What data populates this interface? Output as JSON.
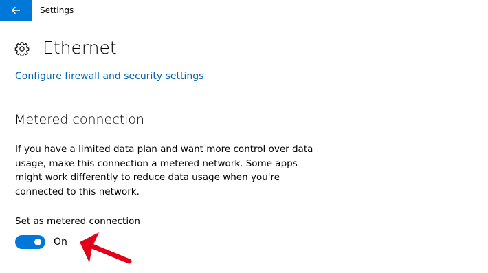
{
  "window": {
    "title": "Settings",
    "back_icon": "arrow-left-icon",
    "accent": "#0078d7"
  },
  "header": {
    "icon": "gear-icon",
    "title": "Ethernet"
  },
  "links": {
    "firewall": "Configure firewall and security settings",
    "link_color": "#0063b1"
  },
  "metered": {
    "section_title": "Metered connection",
    "description": "If you have a limited data plan and want more control over data usage, make this connection a metered network. Some apps might work differently to reduce data usage when you're connected to this network.",
    "toggle_label": "Set as metered connection",
    "toggle_state": "On",
    "toggle_on": true
  },
  "annotation": {
    "icon": "red-arrow-icon",
    "color": "#e2001a"
  }
}
